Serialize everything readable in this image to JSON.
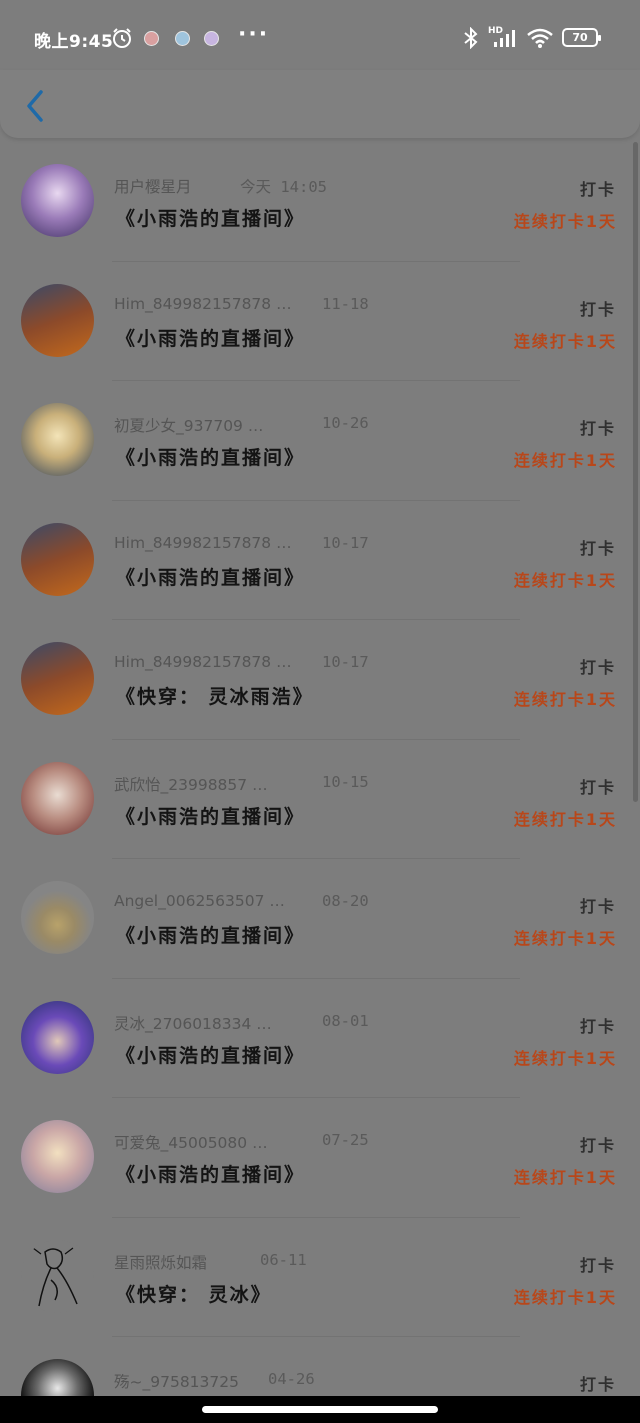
{
  "status_bar": {
    "time": "晚上9:45",
    "battery": "70",
    "network": "HD"
  },
  "header": {
    "back_icon": "chevron-left-icon"
  },
  "colors": {
    "overlay_background": "#7d7d7d",
    "streak_text": "#b8471a",
    "room_text": "#141414"
  },
  "records": [
    {
      "user": "用户樱星月",
      "time": "今天 14:05",
      "room": "《小雨浩的直播间》",
      "checkin": "打卡",
      "streak": "连续打卡1天",
      "avatar": "anime-girl-purple-avatar"
    },
    {
      "user": "Him_849982157878 …",
      "time": "11-18",
      "room": "《小雨浩的直播间》",
      "checkin": "打卡",
      "streak": "连续打卡1天",
      "avatar": "blocky-character-avatar"
    },
    {
      "user": "初夏少女_937709 …",
      "time": "10-26",
      "room": "《小雨浩的直播间》",
      "checkin": "打卡",
      "streak": "连续打卡1天",
      "avatar": "anime-blonde-girl-avatar"
    },
    {
      "user": "Him_849982157878 …",
      "time": "10-17",
      "room": "《小雨浩的直播间》",
      "checkin": "打卡",
      "streak": "连续打卡1天",
      "avatar": "blocky-character-avatar"
    },
    {
      "user": "Him_849982157878 …",
      "time": "10-17",
      "room": "《快穿：  灵冰雨浩》",
      "checkin": "打卡",
      "streak": "连续打卡1天",
      "avatar": "blocky-character-avatar"
    },
    {
      "user": "武欣怡_23998857 …",
      "time": "10-15",
      "room": "《小雨浩的直播间》",
      "checkin": "打卡",
      "streak": "连续打卡1天",
      "avatar": "anime-red-dress-avatar"
    },
    {
      "user": "Angel_0062563507 …",
      "time": "08-20",
      "room": "《小雨浩的直播间》",
      "checkin": "打卡",
      "streak": "连续打卡1天",
      "avatar": "cartoon-dogs-avatar"
    },
    {
      "user": "灵冰_2706018334 …",
      "time": "08-01",
      "room": "《小雨浩的直播间》",
      "checkin": "打卡",
      "streak": "连续打卡1天",
      "avatar": "anime-purple-hair-avatar"
    },
    {
      "user": "可爱兔_45005080 …",
      "time": "07-25",
      "room": "《小雨浩的直播间》",
      "checkin": "打卡",
      "streak": "连续打卡1天",
      "avatar": "anime-cute-girl-avatar"
    },
    {
      "user": "星雨照烁如霜",
      "time": "06-11",
      "room": "《快穿：  灵冰》",
      "checkin": "打卡",
      "streak": "连续打卡1天",
      "avatar": "line-sketch-avatar"
    },
    {
      "user": "殇~_975813725",
      "time": "04-26",
      "room": "",
      "checkin": "打卡",
      "streak": "",
      "avatar": "black-cat-avatar"
    }
  ]
}
